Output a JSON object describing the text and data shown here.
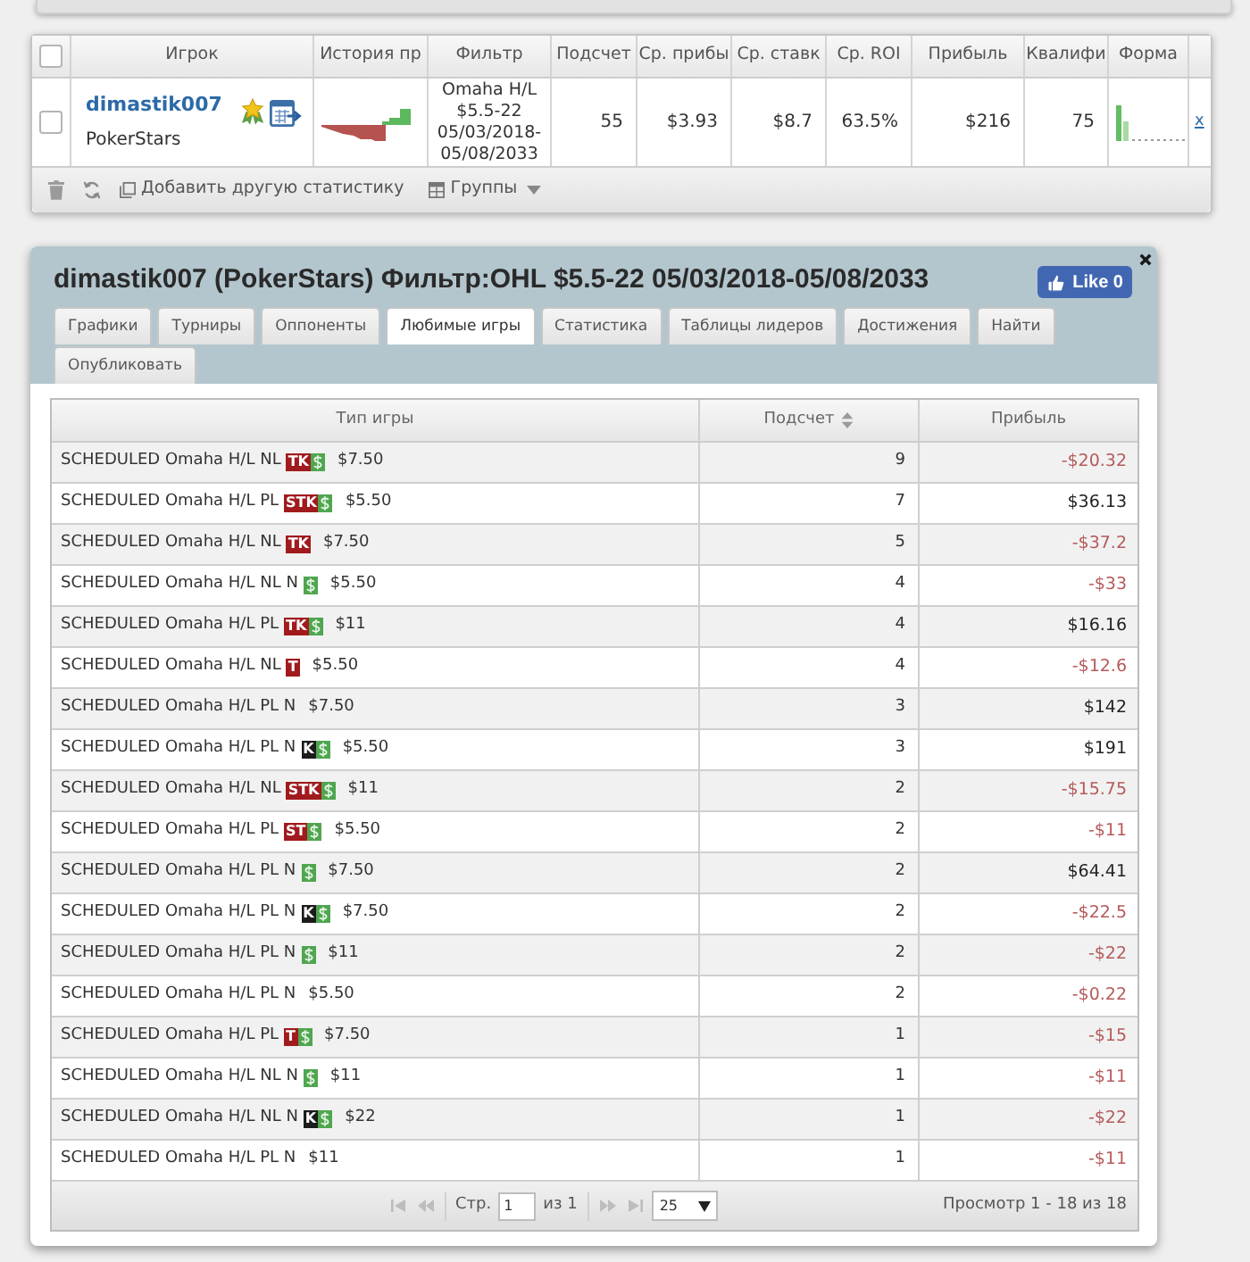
{
  "stats_table": {
    "select_all": {
      "checked": false
    },
    "columns": [
      "Игрок",
      "История пр",
      "Фильтр",
      "Подсчет",
      "Ср. прибы",
      "Ср. ставк",
      "Ср. ROI",
      "Прибыль",
      "Квалифи",
      "Форма"
    ],
    "rows": [
      {
        "checked": false,
        "player": "dimastik007",
        "site": "PokerStars",
        "filter": "Omaha H/L $5.5-22 05/03/2018-05/08/2033",
        "stats": [
          "55",
          "$3.93",
          "$8.7",
          "63.5%",
          "$216",
          "75"
        ],
        "remove": "x"
      }
    ],
    "toolbar": {
      "add": "Добавить другую статистику",
      "groups": "Группы"
    }
  },
  "panel": {
    "title": "dimastik007 (PokerStars) Фильтр:OHL $5.5-22 05/03/2018-05/08/2033",
    "like": "Like 0",
    "tabs": [
      {
        "label": "Графики",
        "selected": false
      },
      {
        "label": "Турниры",
        "selected": false
      },
      {
        "label": "Оппоненты",
        "selected": false
      },
      {
        "label": "Любимые игры",
        "selected": true
      },
      {
        "label": "Статистика",
        "selected": false
      },
      {
        "label": "Таблицы лидеров",
        "selected": false
      },
      {
        "label": "Достижения",
        "selected": false
      },
      {
        "label": "Найти",
        "selected": false
      },
      {
        "label": "Опубликовать",
        "selected": false
      }
    ],
    "games": {
      "columns": [
        {
          "label": "Тип игры",
          "sortable": false
        },
        {
          "label": "Подсчет",
          "sortable": true
        },
        {
          "label": "Прибыль",
          "sortable": false
        }
      ],
      "rows": [
        {
          "game": "SCHEDULED Omaha H/L NL",
          "badge": {
            "label": "TK",
            "color": "#a11a1d"
          },
          "cash": true,
          "buyin": "$7.50",
          "count": "9",
          "profit": "-$20.32",
          "loss": true
        },
        {
          "game": "SCHEDULED Omaha H/L PL",
          "badge": {
            "label": "STK",
            "color": "#a11a1d"
          },
          "cash": true,
          "buyin": "$5.50",
          "count": "7",
          "profit": "$36.13",
          "loss": false
        },
        {
          "game": "SCHEDULED Omaha H/L NL",
          "badge": {
            "label": "TK",
            "color": "#a11a1d"
          },
          "cash": false,
          "buyin": "$7.50",
          "count": "5",
          "profit": "-$37.2",
          "loss": true
        },
        {
          "game": "SCHEDULED Omaha H/L NL N",
          "cash": true,
          "buyin": "$5.50",
          "count": "4",
          "profit": "-$33",
          "loss": true
        },
        {
          "game": "SCHEDULED Omaha H/L PL",
          "badge": {
            "label": "TK",
            "color": "#a11a1d"
          },
          "cash": true,
          "buyin": "$11",
          "count": "4",
          "profit": "$16.16",
          "loss": false
        },
        {
          "game": "SCHEDULED Omaha H/L NL",
          "badge": {
            "label": "T",
            "color": "#a11a1d"
          },
          "cash": false,
          "buyin": "$5.50",
          "count": "4",
          "profit": "-$12.6",
          "loss": true
        },
        {
          "game": "SCHEDULED Omaha H/L PL N",
          "cash": false,
          "buyin": "$7.50",
          "count": "3",
          "profit": "$142",
          "loss": false
        },
        {
          "game": "SCHEDULED Omaha H/L PL N",
          "badge": {
            "label": "K",
            "color": "#1c1c1c"
          },
          "cash": true,
          "buyin": "$5.50",
          "count": "3",
          "profit": "$191",
          "loss": false
        },
        {
          "game": "SCHEDULED Omaha H/L NL",
          "badge": {
            "label": "STK",
            "color": "#a11a1d"
          },
          "cash": true,
          "buyin": "$11",
          "count": "2",
          "profit": "-$15.75",
          "loss": true
        },
        {
          "game": "SCHEDULED Omaha H/L PL",
          "badge": {
            "label": "ST",
            "color": "#a11a1d"
          },
          "cash": true,
          "buyin": "$5.50",
          "count": "2",
          "profit": "-$11",
          "loss": true
        },
        {
          "game": "SCHEDULED Omaha H/L PL N",
          "cash": true,
          "buyin": "$7.50",
          "count": "2",
          "profit": "$64.41",
          "loss": false
        },
        {
          "game": "SCHEDULED Omaha H/L PL N",
          "badge": {
            "label": "K",
            "color": "#1c1c1c"
          },
          "cash": true,
          "buyin": "$7.50",
          "count": "2",
          "profit": "-$22.5",
          "loss": true
        },
        {
          "game": "SCHEDULED Omaha H/L PL N",
          "cash": true,
          "buyin": "$11",
          "count": "2",
          "profit": "-$22",
          "loss": true
        },
        {
          "game": "SCHEDULED Omaha H/L PL N",
          "cash": false,
          "buyin": "$5.50",
          "count": "2",
          "profit": "-$0.22",
          "loss": true
        },
        {
          "game": "SCHEDULED Omaha H/L PL",
          "badge": {
            "label": "T",
            "color": "#a11a1d"
          },
          "cash": true,
          "buyin": "$7.50",
          "count": "1",
          "profit": "-$15",
          "loss": true
        },
        {
          "game": "SCHEDULED Omaha H/L NL N",
          "cash": true,
          "buyin": "$11",
          "count": "1",
          "profit": "-$11",
          "loss": true
        },
        {
          "game": "SCHEDULED Omaha H/L NL N",
          "badge": {
            "label": "K",
            "color": "#1c1c1c"
          },
          "cash": true,
          "buyin": "$22",
          "count": "1",
          "profit": "-$22",
          "loss": true
        },
        {
          "game": "SCHEDULED Omaha H/L PL N",
          "cash": false,
          "buyin": "$11",
          "count": "1",
          "profit": "-$11",
          "loss": true
        }
      ]
    },
    "pager": {
      "page_label": "Стр.",
      "page": "1",
      "of": "из 1",
      "page_size": "25",
      "summary": "Просмотр 1 - 18 из 18",
      "prev_disabled": true,
      "next_disabled": true
    }
  }
}
